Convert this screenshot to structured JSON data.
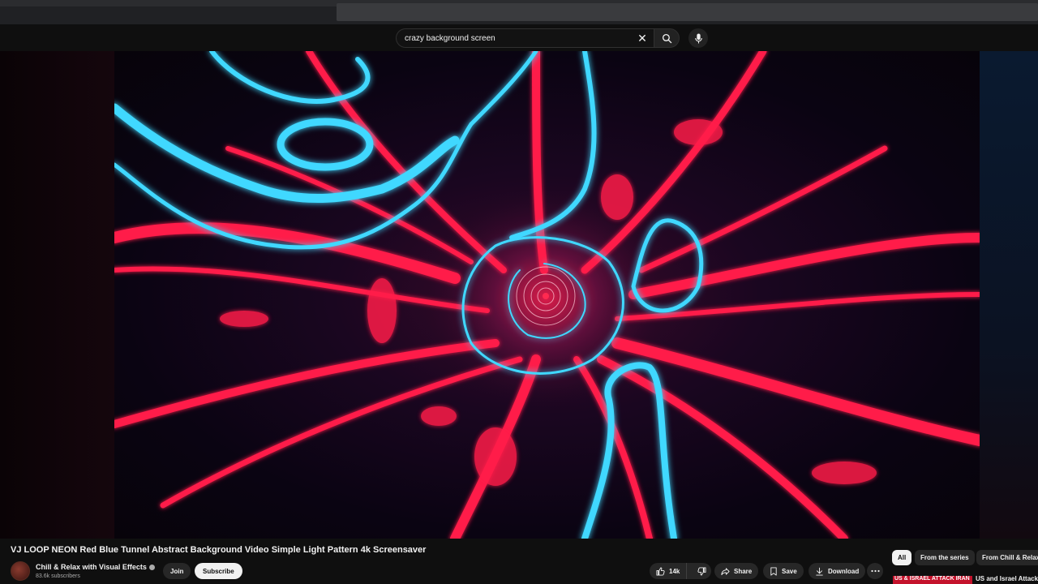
{
  "search": {
    "query": "crazy background screen",
    "clear_icon": "close-icon",
    "search_icon": "search-icon",
    "mic_icon": "mic-icon"
  },
  "video": {
    "title": "VJ LOOP NEON Red Blue Tunnel Abstract Background Video Simple Light Pattern 4k Screensaver"
  },
  "channel": {
    "name": "Chill & Relax with Visual Effects",
    "subscribers": "83.6k subscribers",
    "join_label": "Join",
    "subscribe_label": "Subscribe"
  },
  "actions": {
    "like_count": "14k",
    "share_label": "Share",
    "save_label": "Save",
    "download_label": "Download"
  },
  "chips": [
    "All",
    "From the series",
    "From Chill & Relax"
  ],
  "recommendation": {
    "thumb_text": "US & ISRAEL ATTACK IRAN",
    "title": "US and Israel Attack"
  },
  "colors": {
    "background": "#0f0f0f",
    "neon_red": "#ff1a4a",
    "neon_blue": "#3fd8ff",
    "news_red": "#c4122b"
  }
}
